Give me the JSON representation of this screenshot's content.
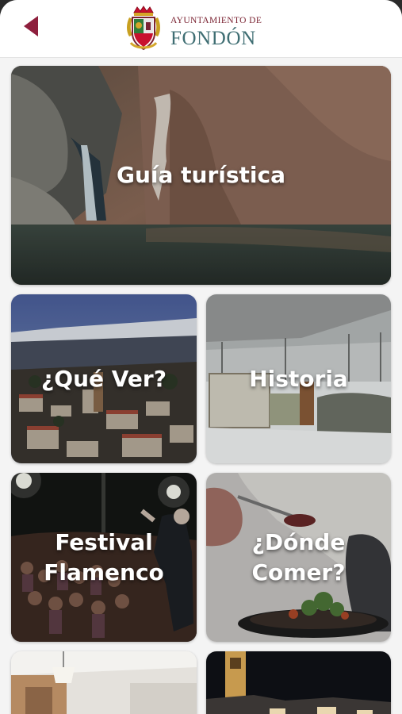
{
  "header": {
    "back_icon": "chevron-left-icon",
    "logo_line1": "AYUNTAMIENTO DE",
    "logo_line2": "FONDÓN",
    "brand_color": "#7b2433",
    "accent_color": "#3f6e73"
  },
  "tiles": [
    {
      "label": "Guía turística"
    },
    {
      "label": "¿Qué Ver?"
    },
    {
      "label": "Historia"
    },
    {
      "label_line1": "Festival",
      "label_line2": "Flamenco"
    },
    {
      "label_line1": "¿Dónde",
      "label_line2": "Comer?"
    },
    {
      "label": ""
    },
    {
      "label": ""
    }
  ]
}
